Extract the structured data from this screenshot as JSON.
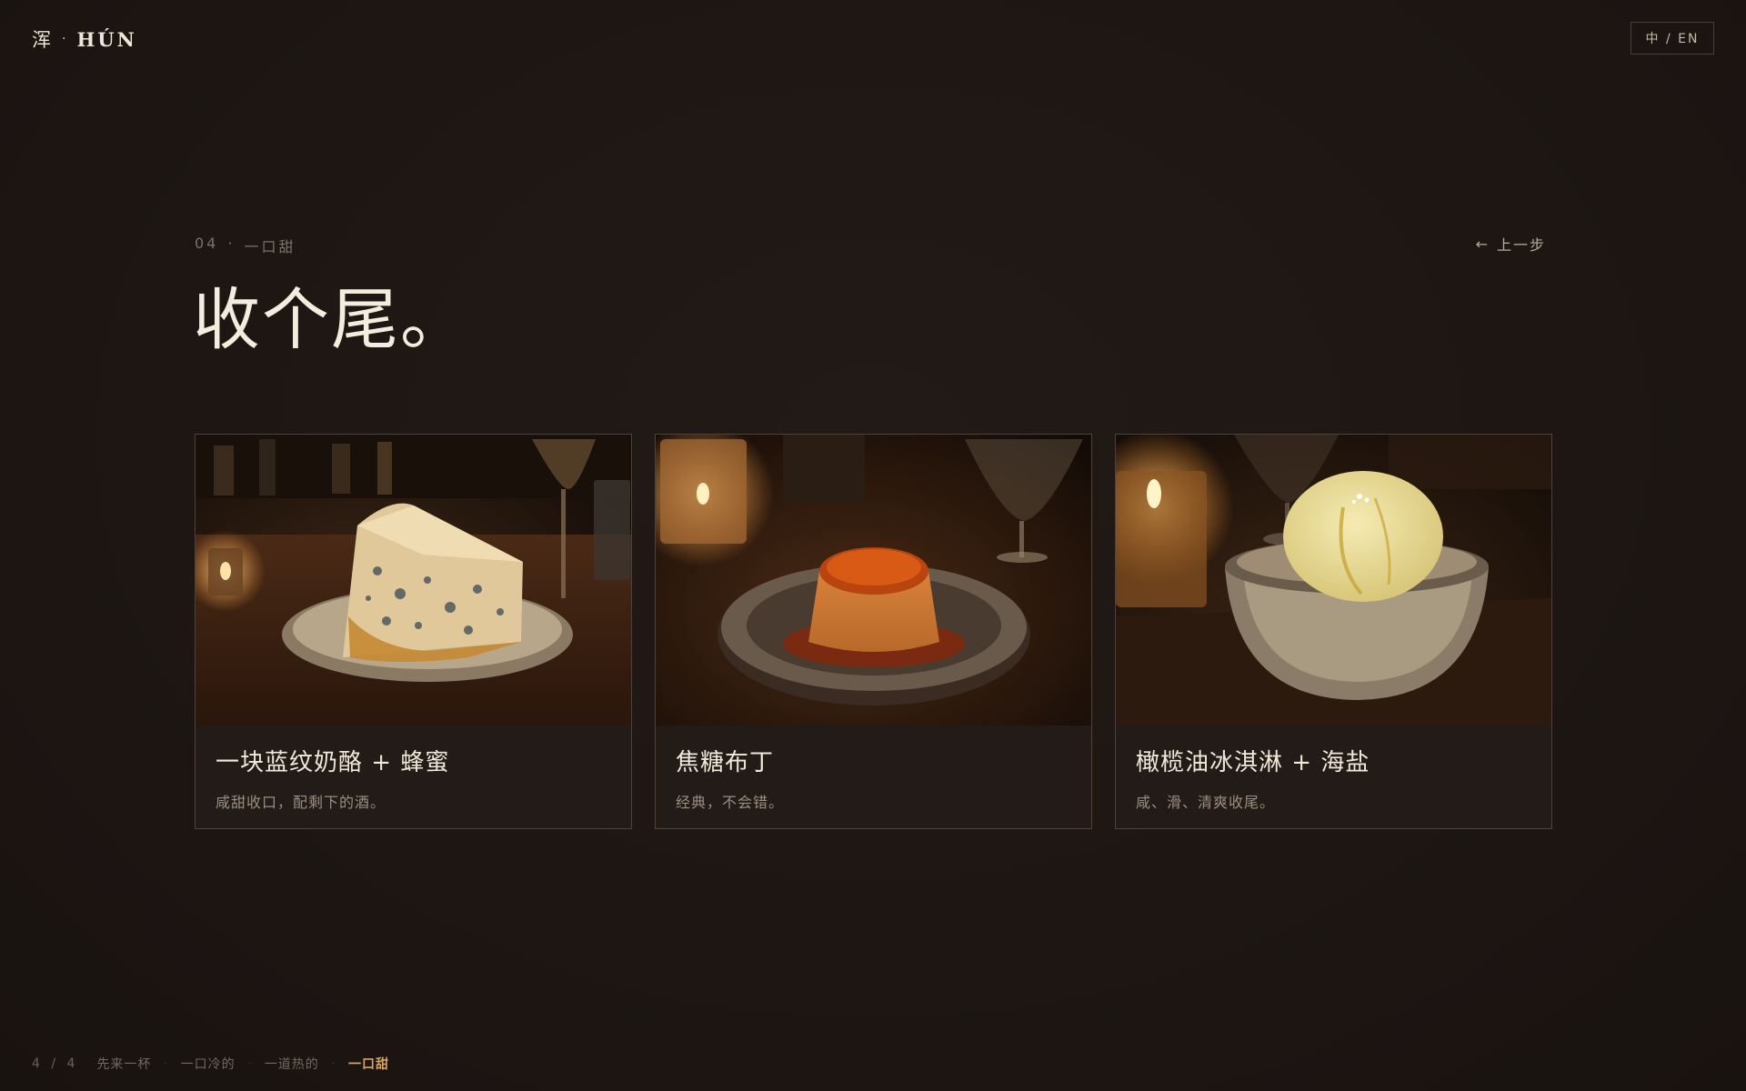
{
  "brand": {
    "cn": "浑",
    "dot": "·",
    "latin": "HÚN"
  },
  "lang_toggle": "中 / EN",
  "section": {
    "number": "04",
    "dot": "·",
    "name": "一口甜"
  },
  "back_label": "上一步",
  "title": "收个尾。",
  "cards": [
    {
      "name": "一块蓝纹奶酪 + 蜂蜜",
      "description": "咸甜收口，配剩下的酒。",
      "image": "blue-cheese-with-honey-photo"
    },
    {
      "name": "焦糖布丁",
      "description": "经典，不会错。",
      "image": "caramel-pudding-photo"
    },
    {
      "name": "橄榄油冰淇淋 + 海盐",
      "description": "咸、滑、清爽收尾。",
      "image": "olive-oil-ice-cream-photo"
    }
  ],
  "progress": {
    "count": "4 / 4",
    "steps": [
      "先来一杯",
      "一口冷的",
      "一道热的",
      "一口甜"
    ],
    "active_index": 3,
    "active_color": "#d7a467"
  },
  "colors": {
    "background": "#1d1613",
    "text": "#efe6d8",
    "accent": "#d7a467",
    "border": "#4e423a"
  }
}
